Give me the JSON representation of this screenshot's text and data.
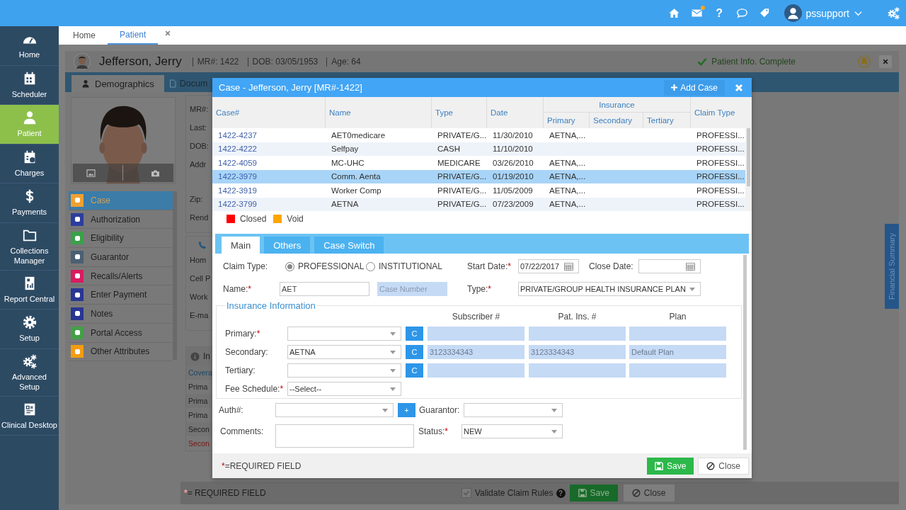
{
  "topbar": {
    "mail_unread": true,
    "help": "?",
    "user": "pssupport"
  },
  "sidebar": {
    "items": [
      {
        "label": "Home",
        "selected": false
      },
      {
        "label": "Scheduler",
        "selected": false
      },
      {
        "label": "Patient",
        "selected": true
      },
      {
        "label": "Charges",
        "selected": false
      },
      {
        "label": "Payments",
        "selected": false
      },
      {
        "label": "Collections Manager",
        "selected": false
      },
      {
        "label": "Report Central",
        "selected": false
      },
      {
        "label": "Setup",
        "selected": false
      },
      {
        "label": "Advanced Setup",
        "selected": false
      },
      {
        "label": "Clinical Desktop",
        "selected": false
      }
    ]
  },
  "tabs": [
    {
      "label": "Home",
      "selected": false,
      "closable": false
    },
    {
      "label": "Patient",
      "selected": true,
      "closable": true
    }
  ],
  "patient": {
    "name": "Jefferson, Jerry",
    "facts": [
      "MR#: 1422",
      "DOB: 03/05/1953",
      "Age: 64"
    ],
    "status": "Patient Info. Complete",
    "tabs": [
      {
        "label": "Demographics",
        "selected": true
      },
      {
        "label": "Docum",
        "selected": false
      }
    ],
    "menu": [
      {
        "label": "Case",
        "selected": true,
        "color": "#f0a030"
      },
      {
        "label": "Authorization",
        "selected": false,
        "color": "#2c3e9c"
      },
      {
        "label": "Eligibility",
        "selected": false,
        "color": "#3aa04a"
      },
      {
        "label": "Guarantor",
        "selected": false,
        "color": "#4a5f72"
      },
      {
        "label": "Recalls/Alerts",
        "selected": false,
        "color": "#d81b60"
      },
      {
        "label": "Enter Payment",
        "selected": false,
        "color": "#283593"
      },
      {
        "label": "Notes",
        "selected": false,
        "color": "#283593"
      },
      {
        "label": "Portal Access",
        "selected": false,
        "color": "#43a047"
      },
      {
        "label": "Other Attributes",
        "selected": false,
        "color": "#f39c12"
      }
    ],
    "fields": [
      "MR#:",
      "Last:",
      "DOB:",
      "Addr",
      "Zip:",
      "Rend"
    ],
    "contacts": [
      "Hom",
      "Cell P",
      "Work",
      "E-ma"
    ],
    "info": {
      "title": "In",
      "rows": [
        {
          "text": "Covera",
          "kind": "head"
        },
        {
          "text": "Prima",
          "kind": "row"
        },
        {
          "text": "Prima",
          "kind": "row"
        },
        {
          "text": "Prima",
          "kind": "row"
        },
        {
          "text": "Secon",
          "kind": "row"
        },
        {
          "text": "Secon",
          "kind": "alert"
        }
      ]
    },
    "footer": {
      "required": {
        "mark": "*",
        "text": "= REQUIRED FIELD"
      },
      "validate": {
        "label": "Validate Claim Rules",
        "checked": true
      },
      "help": "?",
      "save": "Save",
      "close": "Close"
    },
    "financial_tab": "Financial Summary"
  },
  "modal": {
    "title": "Case - Jefferson, Jerry [MR#-1422]",
    "add_button": "Add Case",
    "table": {
      "columns": [
        "Case#",
        "Name",
        "Type",
        "Date"
      ],
      "group": {
        "label": "Insurance",
        "columns": [
          "Primary",
          "Secondary",
          "Tertiary"
        ]
      },
      "last_column": "Claim Type",
      "rows": [
        {
          "case": "1422-4237",
          "name": "AET0medicare",
          "type": "PRIVATE/G...",
          "date": "11/30/2010",
          "primary": "AETNA,...",
          "claim_type": "PROFESSI...",
          "selected": false
        },
        {
          "case": "1422-4222",
          "name": "Selfpay",
          "type": "CASH",
          "date": "11/10/2010",
          "claim_type": "PROFESSI...",
          "selected": false
        },
        {
          "case": "1422-4059",
          "name": "MC-UHC",
          "type": "MEDICARE",
          "date": "03/26/2010",
          "primary": "AETNA,...",
          "claim_type": "PROFESSI...",
          "selected": false
        },
        {
          "case": "1422-3979",
          "name": "Comm. Aenta",
          "type": "PRIVATE/G...",
          "date": "01/19/2010",
          "primary": "AETNA,...",
          "claim_type": "PROFESSI...",
          "selected": true
        },
        {
          "case": "1422-3919",
          "name": "Worker Comp",
          "type": "PRIVATE/G...",
          "date": "11/05/2009",
          "primary": "AETNA,...",
          "claim_type": "PROFESSI...",
          "selected": false
        },
        {
          "case": "1422-3799",
          "name": "AETNA",
          "type": "PRIVATE/G...",
          "date": "07/23/2009",
          "primary": "AETNA,...",
          "claim_type": "PROFESSI...",
          "selected": false
        }
      ]
    },
    "legend": [
      {
        "label": "Closed",
        "color": "#ff0000"
      },
      {
        "label": "Void",
        "color": "#ffa500"
      }
    ],
    "form_tabs": [
      {
        "label": "Main",
        "selected": true
      },
      {
        "label": "Others",
        "selected": false
      },
      {
        "label": "Case Switch",
        "selected": false
      }
    ],
    "form": {
      "claim_type": {
        "label": "Claim Type:",
        "options": [
          {
            "label": "PROFESSIONAL",
            "selected": true
          },
          {
            "label": "INSTITUTIONAL",
            "selected": false
          }
        ]
      },
      "start_date": {
        "label": "Start Date:",
        "req": "*",
        "value": "07/22/2017"
      },
      "close_date": {
        "label": "Close Date:"
      },
      "name": {
        "label": "Name:",
        "req": "*",
        "value": "AET"
      },
      "case_number": {
        "placeholder": "Case Number"
      },
      "type": {
        "label": "Type:",
        "req": "*",
        "value": "PRIVATE/GROUP HEALTH INSURANCE PLAN"
      },
      "insurance": {
        "title": "Insurance Information",
        "columns": [
          "Subscriber #",
          "Pat. Ins. #",
          "Plan"
        ],
        "rows": [
          {
            "label": "Primary:",
            "req": "*",
            "button": "C"
          },
          {
            "label": "Secondary:",
            "value": "AETNA",
            "button": "C",
            "subscriber": "3123334343",
            "pat_ins": "3123334343",
            "plan": "Default Plan"
          },
          {
            "label": "Tertiary:",
            "button": "C"
          }
        ],
        "fee_schedule": {
          "label": "Fee Schedule:",
          "req": "*",
          "value": "--Select--"
        }
      },
      "auth": {
        "label": "Auth#:",
        "button": "+"
      },
      "guarantor": {
        "label": "Guarantor:"
      },
      "comments": {
        "label": "Comments:"
      },
      "status": {
        "label": "Status:",
        "req": "*",
        "value": "NEW"
      }
    },
    "footer": {
      "required": {
        "mark": "*",
        "text": "=REQUIRED FIELD"
      },
      "save": "Save",
      "close": "Close"
    }
  }
}
